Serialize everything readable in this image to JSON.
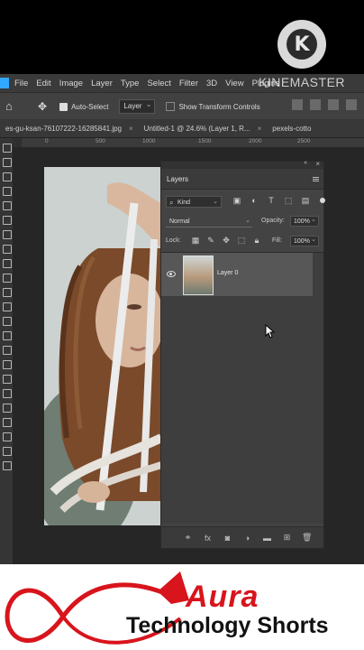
{
  "overlay": {
    "logo_letter": "K",
    "watermark": "KINEMASTER"
  },
  "menubar": {
    "items": [
      "File",
      "Edit",
      "Image",
      "Layer",
      "Type",
      "Select",
      "Filter",
      "3D",
      "View",
      "Plugins"
    ]
  },
  "options": {
    "auto_select_label": "Auto-Select",
    "auto_select_target": "Layer",
    "transform_controls_label": "Show Transform Controls"
  },
  "tabs": [
    {
      "label": "es-gu-ksan-76107222-16285841.jpg"
    },
    {
      "label": "Untitled-1 @ 24.6% (Layer 1, R..."
    },
    {
      "label": "pexels-cotto"
    }
  ],
  "ruler": {
    "marks": [
      "0",
      "500",
      "1000",
      "1500",
      "2000",
      "2500"
    ]
  },
  "layers_panel": {
    "title": "Layers",
    "filter_kind": "Kind",
    "blend_mode": "Normal",
    "opacity_label": "Opacity:",
    "opacity_value": "100%",
    "lock_label": "Lock:",
    "fill_label": "Fill:",
    "fill_value": "100%",
    "layers": [
      {
        "name": "Layer 0",
        "visible": true
      }
    ]
  },
  "footer": {
    "brand_title": "Aura",
    "brand_subtitle": "Technology Shorts"
  },
  "colors": {
    "ps_accent": "#31a8ff",
    "brand_red": "#d8141c"
  }
}
